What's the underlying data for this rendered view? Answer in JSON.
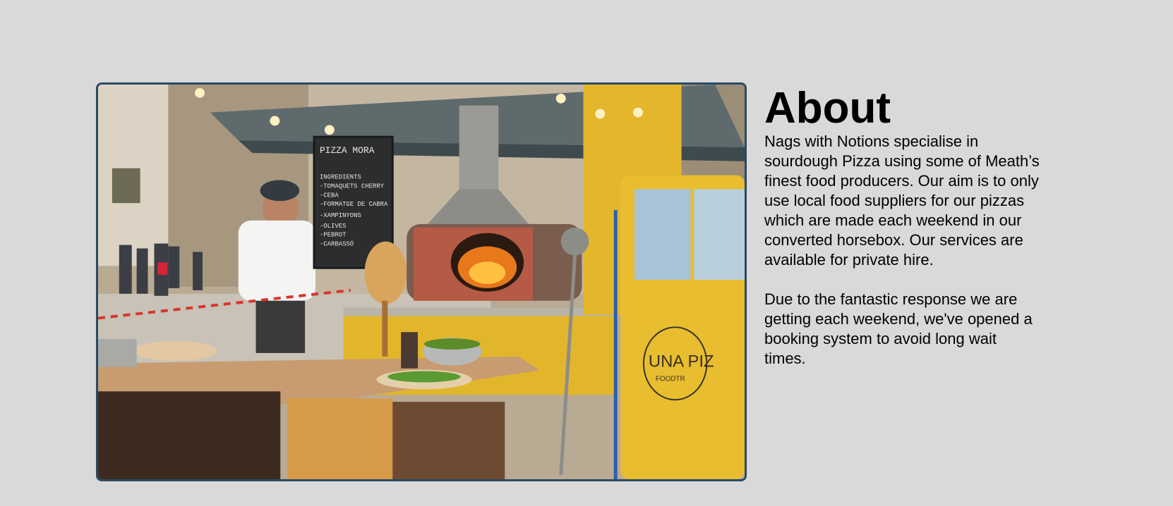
{
  "about": {
    "heading": "About",
    "paragraphs": [
      "Nags with Notions specialise in sourdough Pizza using some of Meath’s finest food producers. Our aim is to only use local food suppliers for our pizzas which are made each weekend in our converted horsebox. Our services are available for private hire.",
      "Due to the fantastic response we are getting each weekend, we've opened a booking system to avoid long wait times."
    ],
    "photo": {
      "menu_board": [
        "PIZZA MORA",
        "INGREDIENTS",
        "-TOMAQUETS CHERRY",
        "-CEBA",
        "-FORMATGE DE CABRA",
        "-XAMPINYONS",
        "-OLIVES",
        "-PEBROT",
        "-CARBASSÓ"
      ],
      "truck_logo": "UNA PIZ",
      "truck_logo_sub": "FOODTR"
    }
  }
}
